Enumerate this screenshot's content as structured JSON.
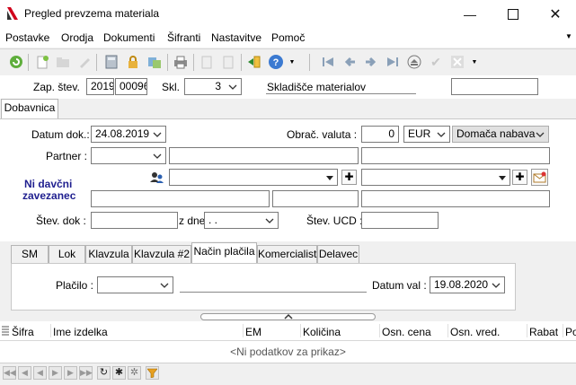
{
  "window": {
    "title": "Pregled prevzema materiala"
  },
  "menu": {
    "items": [
      "Postavke",
      "Orodja",
      "Dokumenti",
      "Šifranti",
      "Nastavitve",
      "Pomoč"
    ]
  },
  "header": {
    "zap_label": "Zap. štev.",
    "year": "2019",
    "number": "00096",
    "skl_label": "Skl.",
    "skl_value": "3",
    "skl_name": "Skladišče materialov",
    "extra": ""
  },
  "main_tab": "Dobavnica",
  "form": {
    "datum_dok_label": "Datum dok.:",
    "datum_dok": "24.08.2019",
    "obrac_valuta_label": "Obrač. valuta :",
    "obrac_valuta": "0",
    "currency": "EUR",
    "nabava": "Domača nabava",
    "partner_label": "Partner :",
    "partner": "",
    "ni_davcni": "Ni davčni",
    "zavezanec": "zavezanec",
    "stev_dok_label": "Štev. dok :",
    "stev_dok": "",
    "z_dne_label": "z dne",
    "z_dne": ". .",
    "stev_ucd_label": "Štev. UCD :",
    "stev_ucd": ""
  },
  "subtabs": [
    "SM",
    "Lok",
    "Klavzula",
    "Klavzula #2",
    "Način plačila",
    "Komercialist",
    "Delavec"
  ],
  "active_subtab": "Način plačila",
  "payment": {
    "placilo_label": "Plačilo :",
    "placilo": "",
    "datum_val_label": "Datum val :",
    "datum_val": "19.08.2020"
  },
  "grid": {
    "columns": [
      "Šifra",
      "Ime izdelka",
      "EM",
      "Količina",
      "Osn. cena",
      "Osn. vred.",
      "Rabat",
      "Po"
    ],
    "empty_text": "<Ni podatkov za prikaz>"
  },
  "colors": {
    "ni_davcni": "#1f1f8f",
    "link_blue": "#1f4aa0"
  }
}
